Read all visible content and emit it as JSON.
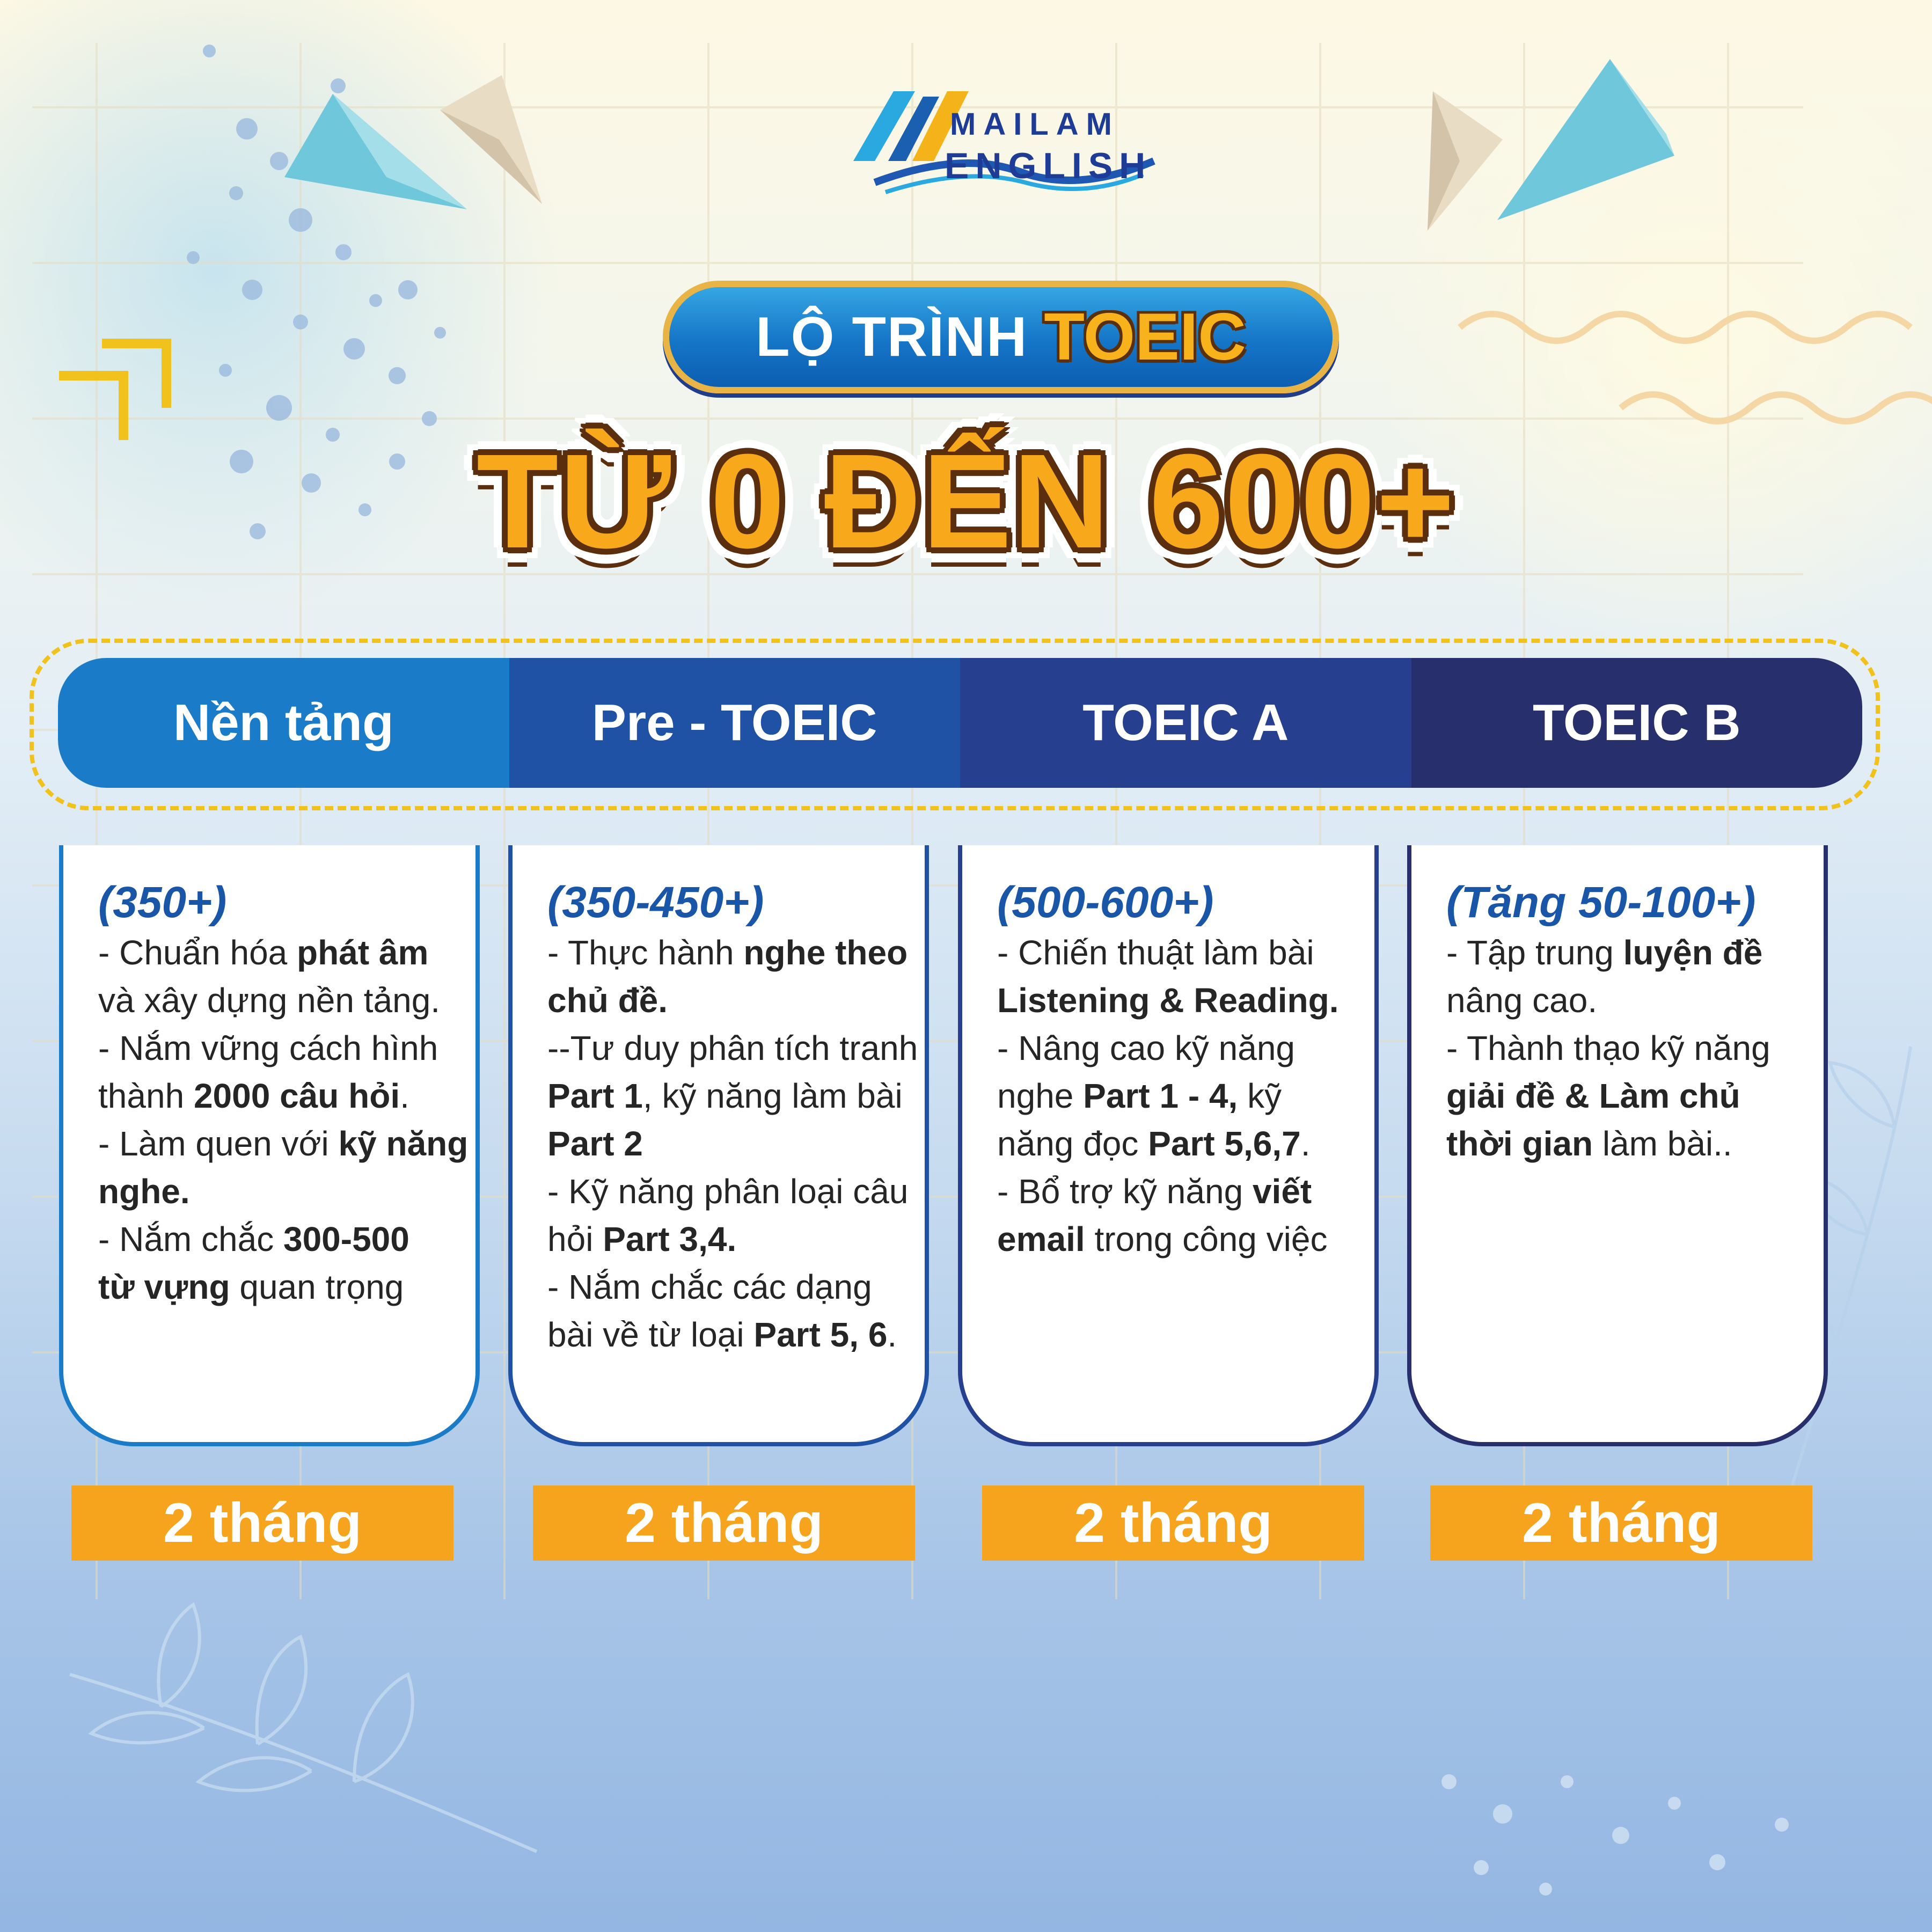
{
  "brand": {
    "logo_top": "MAILAM",
    "logo_bottom": "ENGLISH"
  },
  "badge": {
    "plain": "LỘ TRÌNH",
    "strong": "TOEIC"
  },
  "headline": "TỪ 0 ĐẾN 600+",
  "colors": {
    "header": [
      "#1a7cc9",
      "#1f51a4",
      "#273f8f",
      "#272f6c"
    ],
    "accent": "#f6a41e",
    "score": "#1a56a8"
  },
  "stages": [
    {
      "title": "Nền tảng",
      "score": "(350+)",
      "lines": [
        [
          {
            "t": "- Chuẩn hóa "
          },
          {
            "t": "phát âm",
            "b": true
          }
        ],
        [
          {
            "t": "và xây dựng nền tảng."
          }
        ],
        [
          {
            "t": "- Nắm vững cách hình"
          }
        ],
        [
          {
            "t": "thành "
          },
          {
            "t": "2000 câu hỏi",
            "b": true
          },
          {
            "t": "."
          }
        ],
        [
          {
            "t": "- Làm quen với "
          },
          {
            "t": "kỹ năng",
            "b": true
          }
        ],
        [
          {
            "t": "nghe.",
            "b": true
          }
        ],
        [
          {
            "t": "- Nắm chắc "
          },
          {
            "t": "300-500",
            "b": true
          }
        ],
        [
          {
            "t": "từ vựng",
            "b": true
          },
          {
            "t": " quan trọng"
          }
        ]
      ],
      "duration": "2 tháng"
    },
    {
      "title": "Pre - TOEIC",
      "score": "(350-450+)",
      "lines": [
        [
          {
            "t": "- Thực hành "
          },
          {
            "t": "nghe theo",
            "b": true
          }
        ],
        [
          {
            "t": "chủ đề.",
            "b": true
          }
        ],
        [
          {
            "t": "--Tư duy phân tích tranh"
          }
        ],
        [
          {
            "t": "Part 1",
            "b": true
          },
          {
            "t": ", kỹ năng làm bài"
          }
        ],
        [
          {
            "t": "Part 2",
            "b": true
          }
        ],
        [
          {
            "t": "- Kỹ năng phân loại câu"
          }
        ],
        [
          {
            "t": "hỏi "
          },
          {
            "t": "Part 3,4.",
            "b": true
          }
        ],
        [
          {
            "t": "- Nắm chắc các dạng"
          }
        ],
        [
          {
            "t": "bài về từ loại "
          },
          {
            "t": "Part 5, 6",
            "b": true
          },
          {
            "t": "."
          }
        ]
      ],
      "duration": "2 tháng"
    },
    {
      "title": "TOEIC A",
      "score": "(500-600+)",
      "lines": [
        [
          {
            "t": "- Chiến thuật làm bài"
          }
        ],
        [
          {
            "t": "Listening & Reading.",
            "b": true
          }
        ],
        [
          {
            "t": "- Nâng cao kỹ năng"
          }
        ],
        [
          {
            "t": "nghe "
          },
          {
            "t": "Part 1 - 4,",
            "b": true
          },
          {
            "t": " kỹ"
          }
        ],
        [
          {
            "t": "năng đọc "
          },
          {
            "t": "Part 5,6,7",
            "b": true
          },
          {
            "t": "."
          }
        ],
        [
          {
            "t": "- Bổ trợ kỹ năng "
          },
          {
            "t": "viết",
            "b": true
          }
        ],
        [
          {
            "t": "email",
            "b": true
          },
          {
            "t": " trong công việc"
          }
        ]
      ],
      "duration": "2 tháng"
    },
    {
      "title": "TOEIC B",
      "score": "(Tăng 50-100+)",
      "lines": [
        [
          {
            "t": "- Tập trung "
          },
          {
            "t": "luyện đề",
            "b": true
          }
        ],
        [
          {
            "t": "nâng cao."
          }
        ],
        [
          {
            "t": "- Thành thạo kỹ năng"
          }
        ],
        [
          {
            "t": "giải đề & Làm chủ",
            "b": true
          }
        ],
        [
          {
            "t": "thời gian",
            "b": true
          },
          {
            "t": " làm bài.."
          }
        ]
      ],
      "duration": "2 tháng"
    }
  ]
}
